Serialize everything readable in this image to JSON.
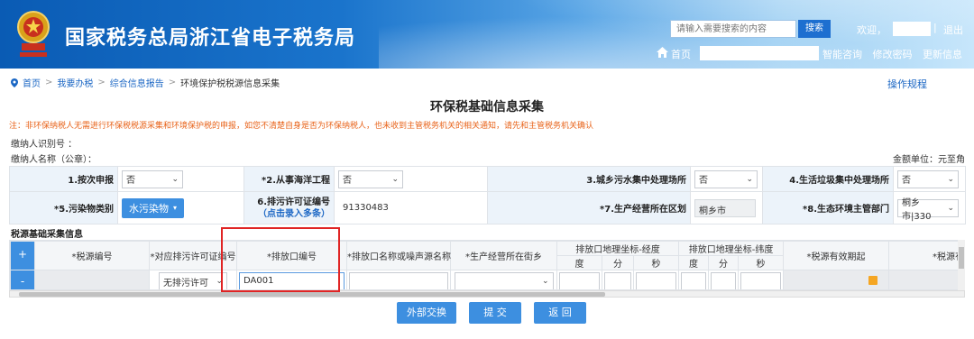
{
  "header": {
    "site_title": "国家税务总局浙江省电子税务局",
    "search_placeholder": "请输入需要搜索的内容",
    "search_button": "搜索",
    "welcome": "欢迎，",
    "logout": "退出",
    "home": "首页",
    "links": [
      "智能咨询",
      "修改密码",
      "更新信息"
    ]
  },
  "breadcrumb": {
    "items": [
      "首页",
      "我要办税",
      "综合信息报告",
      "环境保护税税源信息采集"
    ],
    "operation_guide": "操作规程"
  },
  "page": {
    "title": "环保税基础信息采集",
    "notice": "注：非环保纳税人无需进行环保税税源采集和环境保护税的申报，如您不清楚自身是否为环保纳税人，也未收到主管税务机关的相关通知，请先和主管税务机关确认",
    "taxpayer_id_label": "缴纳人识别号 ：",
    "taxpayer_name_label": "缴纳人名称（公章）：",
    "unit_note": "金额单位：元至角"
  },
  "form": {
    "row1": [
      {
        "label": "1.按次申报",
        "value": "否"
      },
      {
        "label": "*2.从事海洋工程",
        "value": "否"
      },
      {
        "label": "3.城乡污水集中处理场所",
        "value": "否"
      },
      {
        "label": "4.生活垃圾集中处理场所",
        "value": "否"
      }
    ],
    "row2": [
      {
        "label": "*5.污染物类别",
        "value": "水污染物"
      },
      {
        "label": "6.排污许可证编号",
        "sublabel": "（点击录入多条）",
        "value": "91330483"
      },
      {
        "label": "*7.生产经营所在区划",
        "value": "桐乡市"
      },
      {
        "label": "*8.生态环境主管部门",
        "value": "桐乡市|330"
      }
    ]
  },
  "grid": {
    "section_title": "税源基础采集信息",
    "add_button": "+",
    "remove_button": "-",
    "headers": {
      "source_no": "*税源编号",
      "permit_no": "*对应排污许可证编号",
      "outlet_no": "*排放口编号",
      "outlet_name": "*排放口名称或噪声源名称",
      "street": "*生产经营所在街乡",
      "longitude": "排放口地理坐标-经度",
      "latitude": "排放口地理坐标-纬度",
      "deg": "度",
      "min": "分",
      "sec": "秒",
      "valid_from": "*税源有效期起",
      "valid_to": "*税源有效"
    },
    "row": {
      "permit_value": "无排污许可",
      "outlet_value": "DA001"
    }
  },
  "actions": {
    "external_exchange": "外部交换",
    "submit": "提 交",
    "back": "返 回"
  }
}
